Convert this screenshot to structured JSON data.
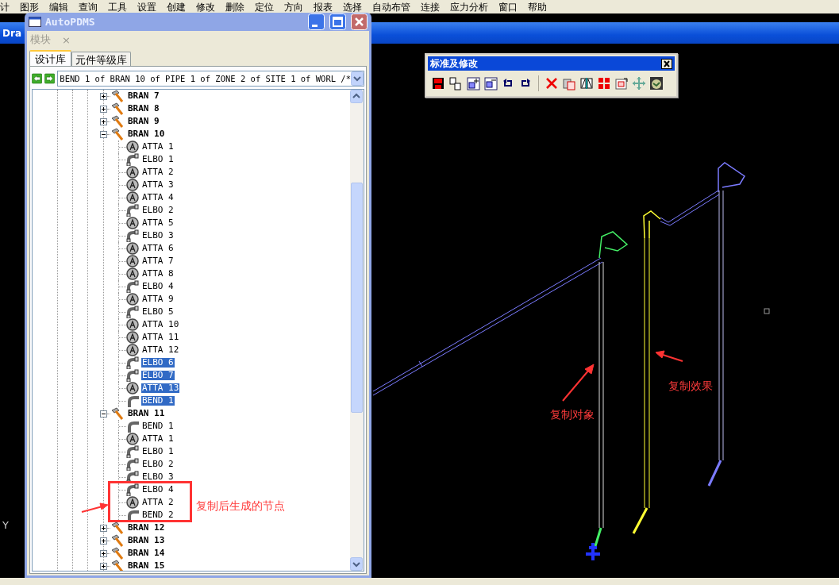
{
  "menu_bar": {
    "items": [
      "计",
      "图形",
      "编辑",
      "查询",
      "工具",
      "设置",
      "创建",
      "修改",
      "删除",
      "定位",
      "方向",
      "报表",
      "选择",
      "自动布管",
      "连接",
      "应力分析",
      "窗口",
      "帮助"
    ]
  },
  "background_window": {
    "title": "Dra"
  },
  "canvas": {
    "axis_label": "Y"
  },
  "dialog": {
    "title": "AutoPDMS",
    "module_menu": "模块",
    "close_glyph": "×",
    "tabs": [
      {
        "label": "设计库",
        "selected": true
      },
      {
        "label": "元件等级库",
        "selected": false
      }
    ],
    "path_field": {
      "value": "BEND 1 of BRAN 10 of PIPE 1 of ZONE 2 of SITE 1 of WORL /*"
    },
    "tree": [
      {
        "label": "BRAN 7",
        "kind": "bran",
        "expanded": false
      },
      {
        "label": "BRAN 8",
        "kind": "bran",
        "expanded": false
      },
      {
        "label": "BRAN 9",
        "kind": "bran",
        "expanded": false
      },
      {
        "label": "BRAN 10",
        "kind": "bran",
        "expanded": true,
        "children": [
          {
            "label": "ATTA 1",
            "kind": "atta",
            "selected": false
          },
          {
            "label": "ELBO 1",
            "kind": "elbo",
            "selected": false
          },
          {
            "label": "ATTA 2",
            "kind": "atta",
            "selected": false
          },
          {
            "label": "ATTA 3",
            "kind": "atta",
            "selected": false
          },
          {
            "label": "ATTA 4",
            "kind": "atta",
            "selected": false
          },
          {
            "label": "ELBO 2",
            "kind": "elbo",
            "selected": false
          },
          {
            "label": "ATTA 5",
            "kind": "atta",
            "selected": false
          },
          {
            "label": "ELBO 3",
            "kind": "elbo",
            "selected": false
          },
          {
            "label": "ATTA 6",
            "kind": "atta",
            "selected": false
          },
          {
            "label": "ATTA 7",
            "kind": "atta",
            "selected": false
          },
          {
            "label": "ATTA 8",
            "kind": "atta",
            "selected": false
          },
          {
            "label": "ELBO 4",
            "kind": "elbo",
            "selected": false
          },
          {
            "label": "ATTA 9",
            "kind": "atta",
            "selected": false
          },
          {
            "label": "ELBO 5",
            "kind": "elbo",
            "selected": false
          },
          {
            "label": "ATTA 10",
            "kind": "atta",
            "selected": false
          },
          {
            "label": "ATTA 11",
            "kind": "atta",
            "selected": false
          },
          {
            "label": "ATTA 12",
            "kind": "atta",
            "selected": false
          },
          {
            "label": "ELBO 6",
            "kind": "elbo",
            "selected": true
          },
          {
            "label": "ELBO 7",
            "kind": "elbo",
            "selected": true
          },
          {
            "label": "ATTA 13",
            "kind": "atta",
            "selected": true
          },
          {
            "label": "BEND 1",
            "kind": "bend",
            "selected": true
          }
        ]
      },
      {
        "label": "BRAN 11",
        "kind": "bran",
        "expanded": true,
        "children": [
          {
            "label": "BEND 1",
            "kind": "bend",
            "selected": false
          },
          {
            "label": "ATTA 1",
            "kind": "atta",
            "selected": false
          },
          {
            "label": "ELBO 1",
            "kind": "elbo",
            "selected": false
          },
          {
            "label": "ELBO 2",
            "kind": "elbo",
            "selected": false
          },
          {
            "label": "ELBO 3",
            "kind": "elbo",
            "selected": false
          },
          {
            "label": "ELBO 4",
            "kind": "elbo",
            "selected": false
          },
          {
            "label": "ATTA 2",
            "kind": "atta",
            "selected": false
          },
          {
            "label": "BEND 2",
            "kind": "bend",
            "selected": false
          }
        ]
      },
      {
        "label": "BRAN 12",
        "kind": "bran",
        "expanded": false
      },
      {
        "label": "BRAN 13",
        "kind": "bran",
        "expanded": false
      },
      {
        "label": "BRAN 14",
        "kind": "bran",
        "expanded": false
      },
      {
        "label": "BRAN 15",
        "kind": "bran",
        "expanded": false
      }
    ]
  },
  "toolbar": {
    "title": "标准及修改"
  },
  "annotations": [
    {
      "kind": "tree",
      "text": "复制后生成的节点"
    },
    {
      "kind": "source",
      "text": "复制对象"
    },
    {
      "kind": "result",
      "text": "复制效果"
    }
  ]
}
